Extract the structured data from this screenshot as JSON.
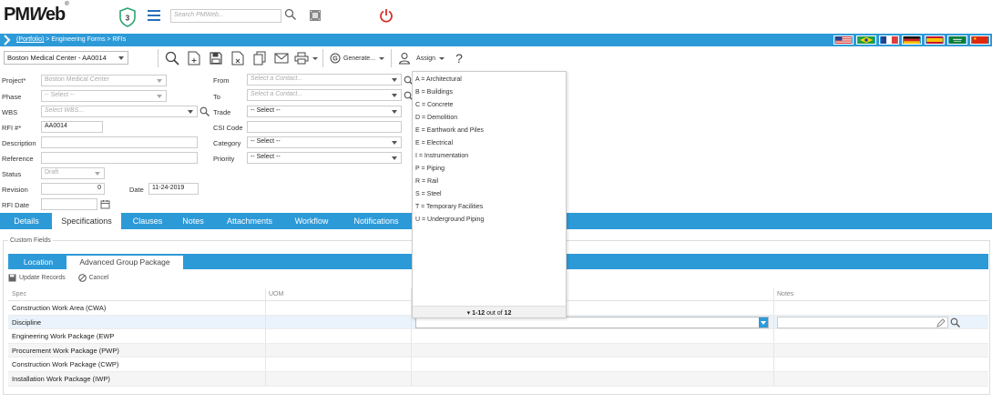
{
  "header": {
    "logo_text": "PMWeb",
    "shield_count": "3",
    "search_placeholder": "Search PMWeb...",
    "icons": [
      "shield-icon",
      "hamburger-icon",
      "search-icon",
      "film-icon",
      "power-icon"
    ]
  },
  "breadcrumb": {
    "portfolio": "(Portfolio)",
    "path": " > Engineering Forms > RFIs"
  },
  "flags": [
    "us",
    "brazil",
    "france",
    "germany",
    "spain",
    "saudi-arabia",
    "china"
  ],
  "toolbar": {
    "project": "Boston Medical Center - AA0014",
    "generate_label": "Generate...",
    "assign_label": "Assign",
    "icons": [
      "search-icon",
      "new-document-icon",
      "save-icon",
      "delete-icon",
      "copy-icon",
      "email-icon",
      "print-icon",
      "generate-icon",
      "user-icon",
      "help-icon"
    ]
  },
  "form": {
    "project_label": "Project*",
    "project_value": "Boston Medical Center",
    "phase_label": "Phase",
    "phase_value": "-- Select --",
    "wbs_label": "WBS",
    "wbs_placeholder": "Select WBS...",
    "rfi_label": "RFI #*",
    "rfi_value": "AA0014",
    "description_label": "Description",
    "reference_label": "Reference",
    "status_label": "Status",
    "status_value": "Draft",
    "revision_label": "Revision",
    "revision_value": "0",
    "date_label": "Date",
    "date_value": "11-24-2019",
    "rfi_date_label": "RFI Date",
    "from_label": "From",
    "from_placeholder": "Select a Contact...",
    "to_label": "To",
    "to_placeholder": "Select a Contact...",
    "trade_label": "Trade",
    "trade_value": "-- Select --",
    "csi_label": "CSI Code",
    "category_label": "Category",
    "category_value": "-- Select --",
    "priority_label": "Priority",
    "priority_value": "-- Select --"
  },
  "dropdown": {
    "items": [
      "A = Architectural",
      "B = Buildings",
      "C = Concrete",
      "D = Demolition",
      "E = Earthwork and Piles",
      "E = Electrical",
      "I = Instrumentation",
      "P = Piping",
      "R = Rail",
      "S = Steel",
      "T = Temporary Facilities",
      "U = Underground Piping"
    ],
    "footer_range": "1-12",
    "footer_mid": " out of ",
    "footer_total": "12"
  },
  "tabs": [
    "Details",
    "Specifications",
    "Clauses",
    "Notes",
    "Attachments",
    "Workflow",
    "Notifications"
  ],
  "custom_fields": {
    "legend": "Custom Fields",
    "subtabs": [
      "Location",
      "Advanced Group Package"
    ],
    "update_label": "Update Records",
    "cancel_label": "Cancel",
    "columns": {
      "spec": "Spec",
      "uom": "UOM",
      "notes": "Notes"
    },
    "rows": [
      "Construction Work Area (CWA)",
      "Discipline",
      "Engineering Work Package (EWP",
      "Procurement Work Package (PWP)",
      "Construction Work Package (CWP)",
      "Installation Work Package (IWP)"
    ]
  },
  "colors": {
    "accent": "#2d9ad8",
    "power": "#d9302b",
    "shield": "#2aa56e"
  }
}
